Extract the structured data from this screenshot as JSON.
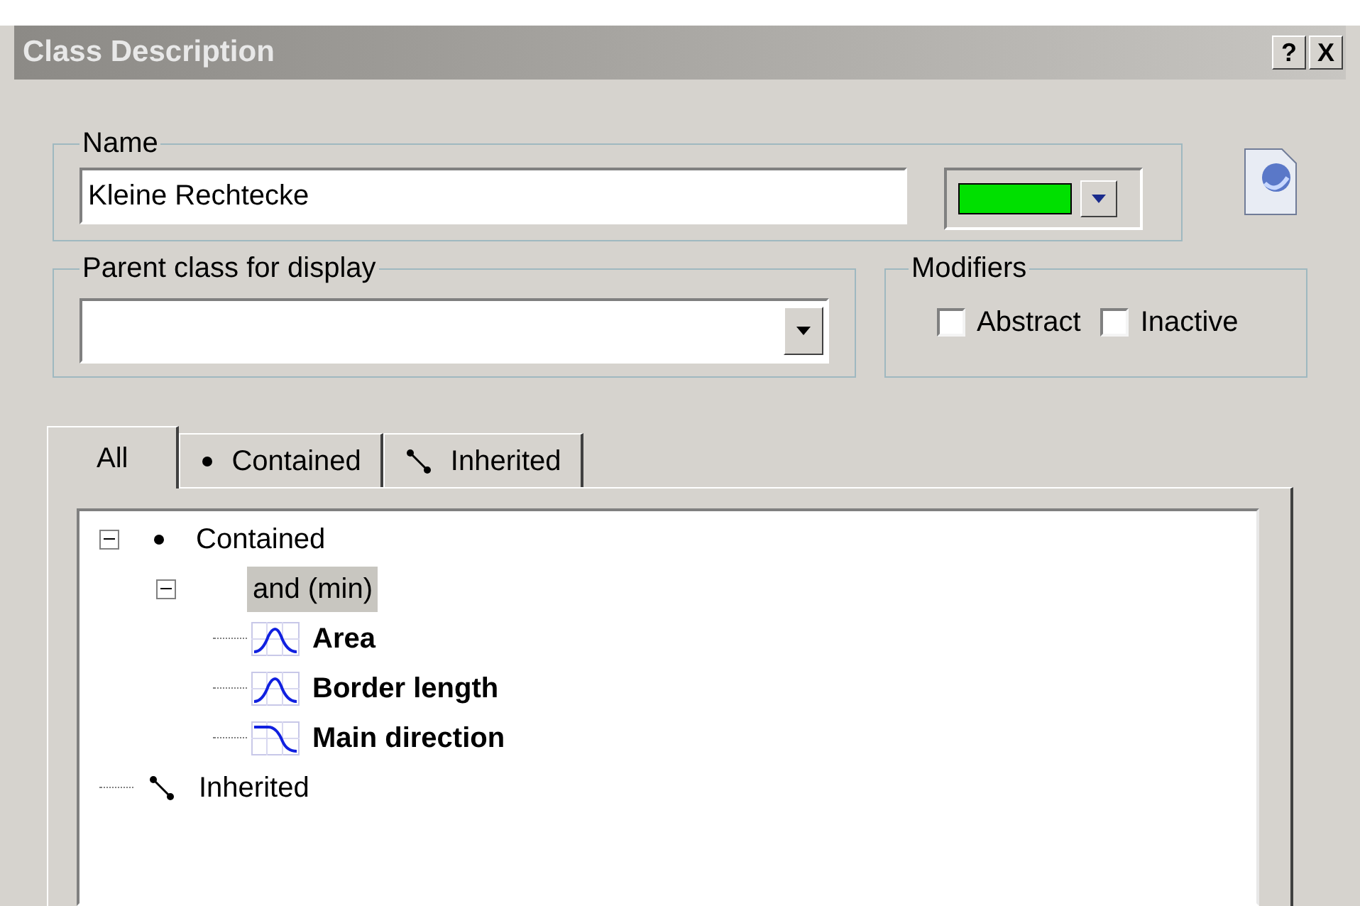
{
  "window": {
    "title": "Class Description",
    "buttons": [
      {
        "label": "?"
      },
      {
        "label": "X"
      }
    ]
  },
  "name_group": {
    "label": "Name",
    "value": "Kleine Rechtecke",
    "color": "#00e000"
  },
  "parent_group": {
    "label": "Parent class for display"
  },
  "modifiers": {
    "label": "Modifiers",
    "options": [
      {
        "label": "Abstract",
        "checked": false
      },
      {
        "label": "Inactive",
        "checked": false
      }
    ]
  },
  "tabs": [
    {
      "label": "All",
      "kind": "none",
      "selected": true
    },
    {
      "label": "Contained",
      "kind": "dot",
      "selected": false
    },
    {
      "label": "Inherited",
      "kind": "link",
      "selected": false
    }
  ],
  "tree": [
    {
      "label": "Contained",
      "kind": "dot",
      "expanded": true,
      "selected": false,
      "children": [
        {
          "label": "and (min)",
          "expanded": true,
          "selected": true,
          "children": [
            {
              "label": "Area",
              "kind": "curve-bell",
              "selected": false
            },
            {
              "label": "Border length",
              "kind": "curve-bell",
              "selected": false
            },
            {
              "label": "Main direction",
              "kind": "curve-fall",
              "selected": false
            }
          ]
        }
      ]
    },
    {
      "label": "Inherited",
      "kind": "link",
      "selected": false
    }
  ]
}
